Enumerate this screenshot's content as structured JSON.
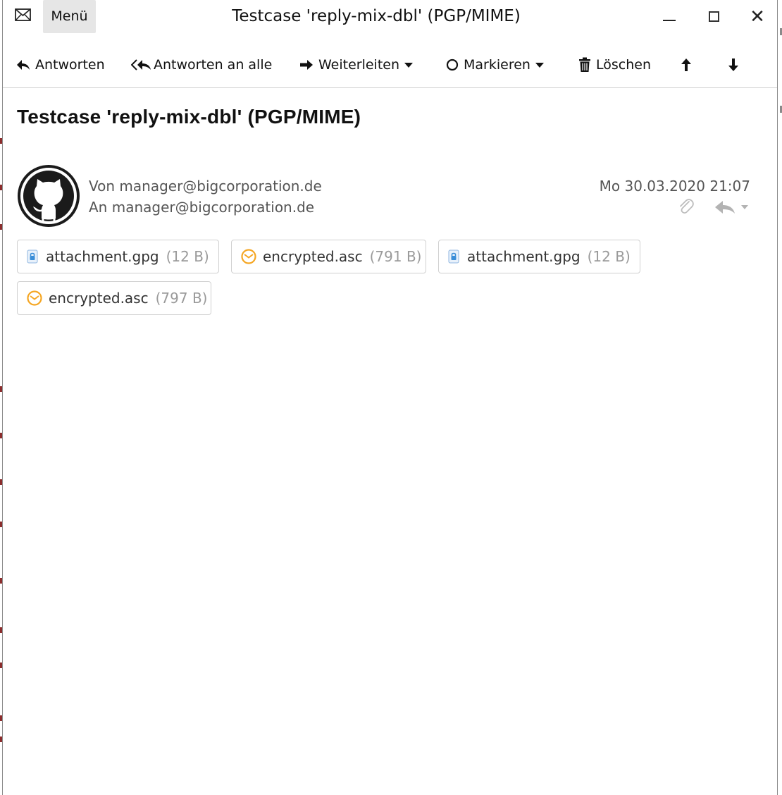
{
  "window": {
    "title": "Testcase 'reply-mix-dbl' (PGP/MIME)",
    "menu_label": "Menü"
  },
  "toolbar": {
    "reply": "Antworten",
    "reply_all": "Antworten an alle",
    "forward": "Weiterleiten",
    "mark": "Markieren",
    "delete": "Löschen"
  },
  "message": {
    "subject": "Testcase 'reply-mix-dbl' (PGP/MIME)",
    "from": "Von manager@bigcorporation.de",
    "to": "An manager@bigcorporation.de",
    "date": "Mo 30.03.2020 21:07"
  },
  "attachments": [
    {
      "name": "attachment.gpg",
      "size": "(12 B)",
      "icon": "lock-icon"
    },
    {
      "name": "encrypted.asc",
      "size": "(791 B)",
      "icon": "encrypted-mail-icon"
    },
    {
      "name": "attachment.gpg",
      "size": "(12 B)",
      "icon": "lock-icon"
    },
    {
      "name": "encrypted.asc",
      "size": "(797 B)",
      "icon": "encrypted-mail-icon"
    }
  ],
  "colors": {
    "menu_bg": "#e6e6e6",
    "lock_blue": "#3b8ed8",
    "encrypted_orange": "#f5a623"
  }
}
